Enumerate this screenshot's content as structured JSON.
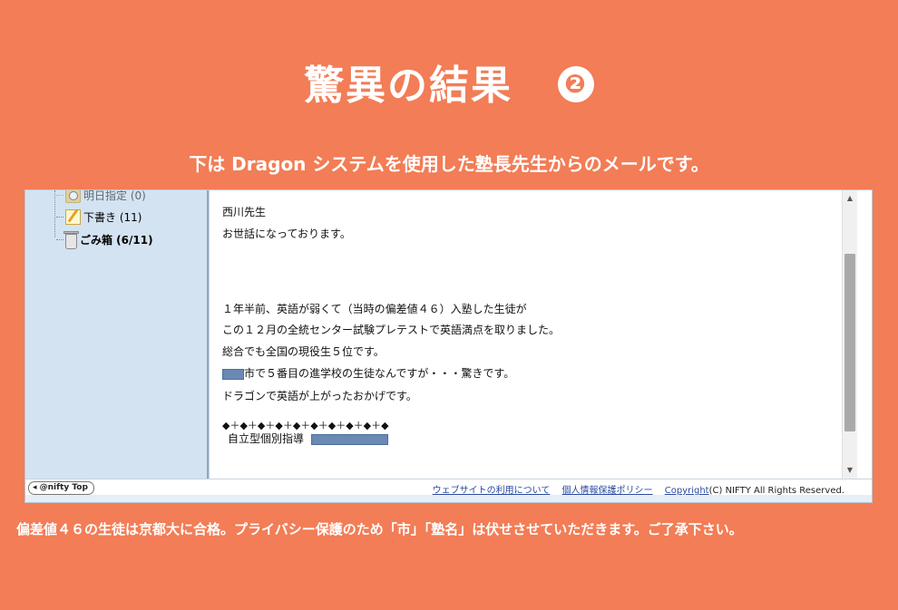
{
  "title": {
    "text": "驚異の結果",
    "number": "❷"
  },
  "subtitle": "下は Dragon システムを使用した塾長先生からのメールです。",
  "sidebar": {
    "folders": [
      {
        "label": "明日指定 (0)",
        "icon": "clock-folder-icon"
      },
      {
        "label": "下書き (11)",
        "icon": "draft-icon"
      },
      {
        "label": "ごみ箱 (6/11)",
        "icon": "trash-icon"
      }
    ]
  },
  "mail": {
    "greeting": "西川先生",
    "intro": "お世話になっております。",
    "line1": "１年半前、英語が弱くて（当時の偏差値４６）入塾した生徒が",
    "line2": "この１２月の全統センター試験プレテストで英語満点を取りました。",
    "line3": "総合でも全国の現役生５位です。",
    "line4_suffix": "市で５番目の進学校の生徒なんですが・・・驚きです。",
    "line5": "ドラゴンで英語が上がったおかげです。",
    "separator": "◆＋◆＋◆＋◆＋◆＋◆＋◆＋◆＋◆＋◆",
    "signature": "自立型個別指導"
  },
  "footer": {
    "nifty_button": "◂ @nifty Top",
    "link_terms": "ウェブサイトの利用について",
    "link_privacy": "個人情報保護ポリシー",
    "link_copyright": "Copyright",
    "copyright_text": "(C) NIFTY  All Rights Reserved."
  },
  "caption": "偏差値４６の生徒は京都大に合格。プライバシー保護のため「市」「塾名」は伏せさせていただきます。ご了承下さい。",
  "colors": {
    "background": "#f27d56",
    "sidebar": "#d4e3f2",
    "mask": "#6a89b3"
  }
}
